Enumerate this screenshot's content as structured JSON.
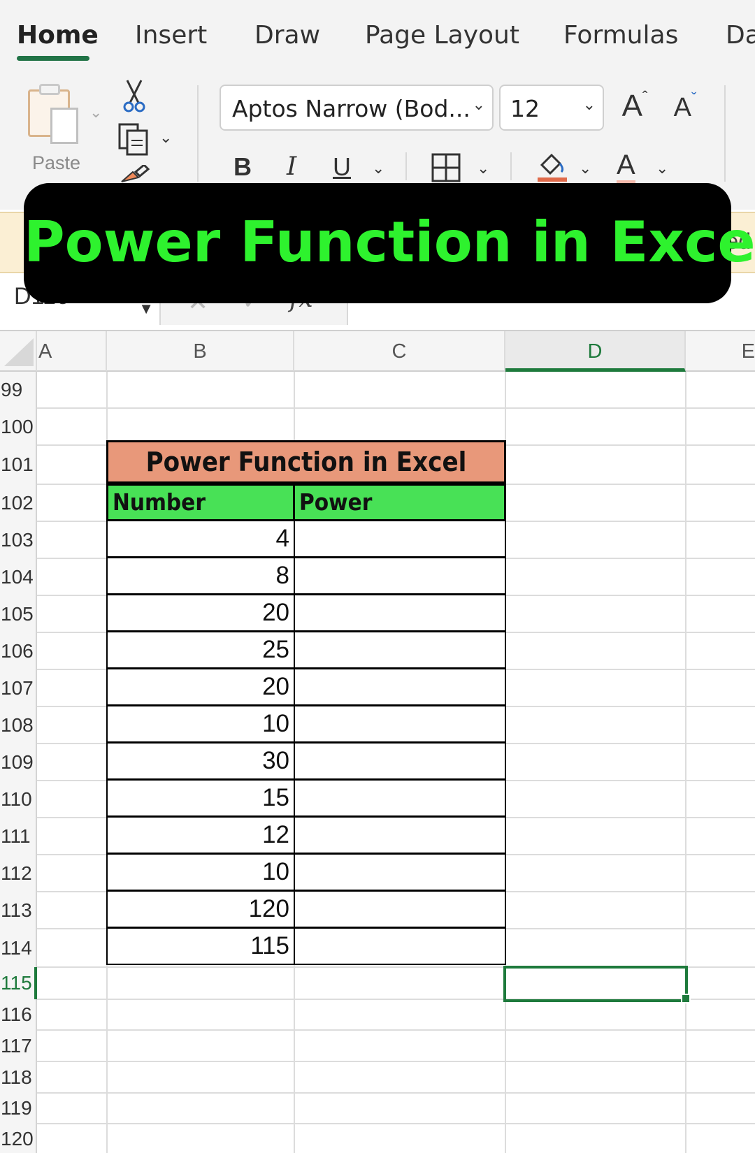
{
  "ribbon": {
    "tabs": [
      "Home",
      "Insert",
      "Draw",
      "Page Layout",
      "Formulas",
      "Da"
    ],
    "active_tab": "Home",
    "paste_label": "Paste",
    "font_name": "Aptos Narrow (Bod...",
    "font_size": "12",
    "bold_label": "B",
    "italic_label": "I",
    "underline_label": "U",
    "grow_font": "A",
    "shrink_font": "A",
    "font_color": "A"
  },
  "banner": {
    "title": "Power Function in Excel"
  },
  "yellow_bar": {
    "edge_text": "ed"
  },
  "formula_bar": {
    "name_box": "D116",
    "fx_label": "fx"
  },
  "grid": {
    "columns": [
      "A",
      "B",
      "C",
      "D",
      "E"
    ],
    "selected_column": "D",
    "rows": [
      "99",
      "100",
      "101",
      "102",
      "103",
      "104",
      "105",
      "106",
      "107",
      "108",
      "109",
      "110",
      "111",
      "112",
      "113",
      "114",
      "115",
      "116",
      "117",
      "118",
      "119",
      "120"
    ],
    "selected_row": "115"
  },
  "table": {
    "title": "Power Function in Excel",
    "headers": [
      "Number",
      "Power"
    ],
    "numbers": [
      "4",
      "8",
      "20",
      "25",
      "20",
      "10",
      "30",
      "15",
      "12",
      "10",
      "120",
      "115"
    ],
    "powers": [
      "",
      "",
      "",
      "",
      "",
      "",
      "",
      "",
      "",
      "",
      "",
      ""
    ]
  },
  "colors": {
    "accent": "#217346",
    "banner_text": "#2ef22e",
    "title_fill": "#e8987a",
    "header_fill": "#48e156"
  }
}
